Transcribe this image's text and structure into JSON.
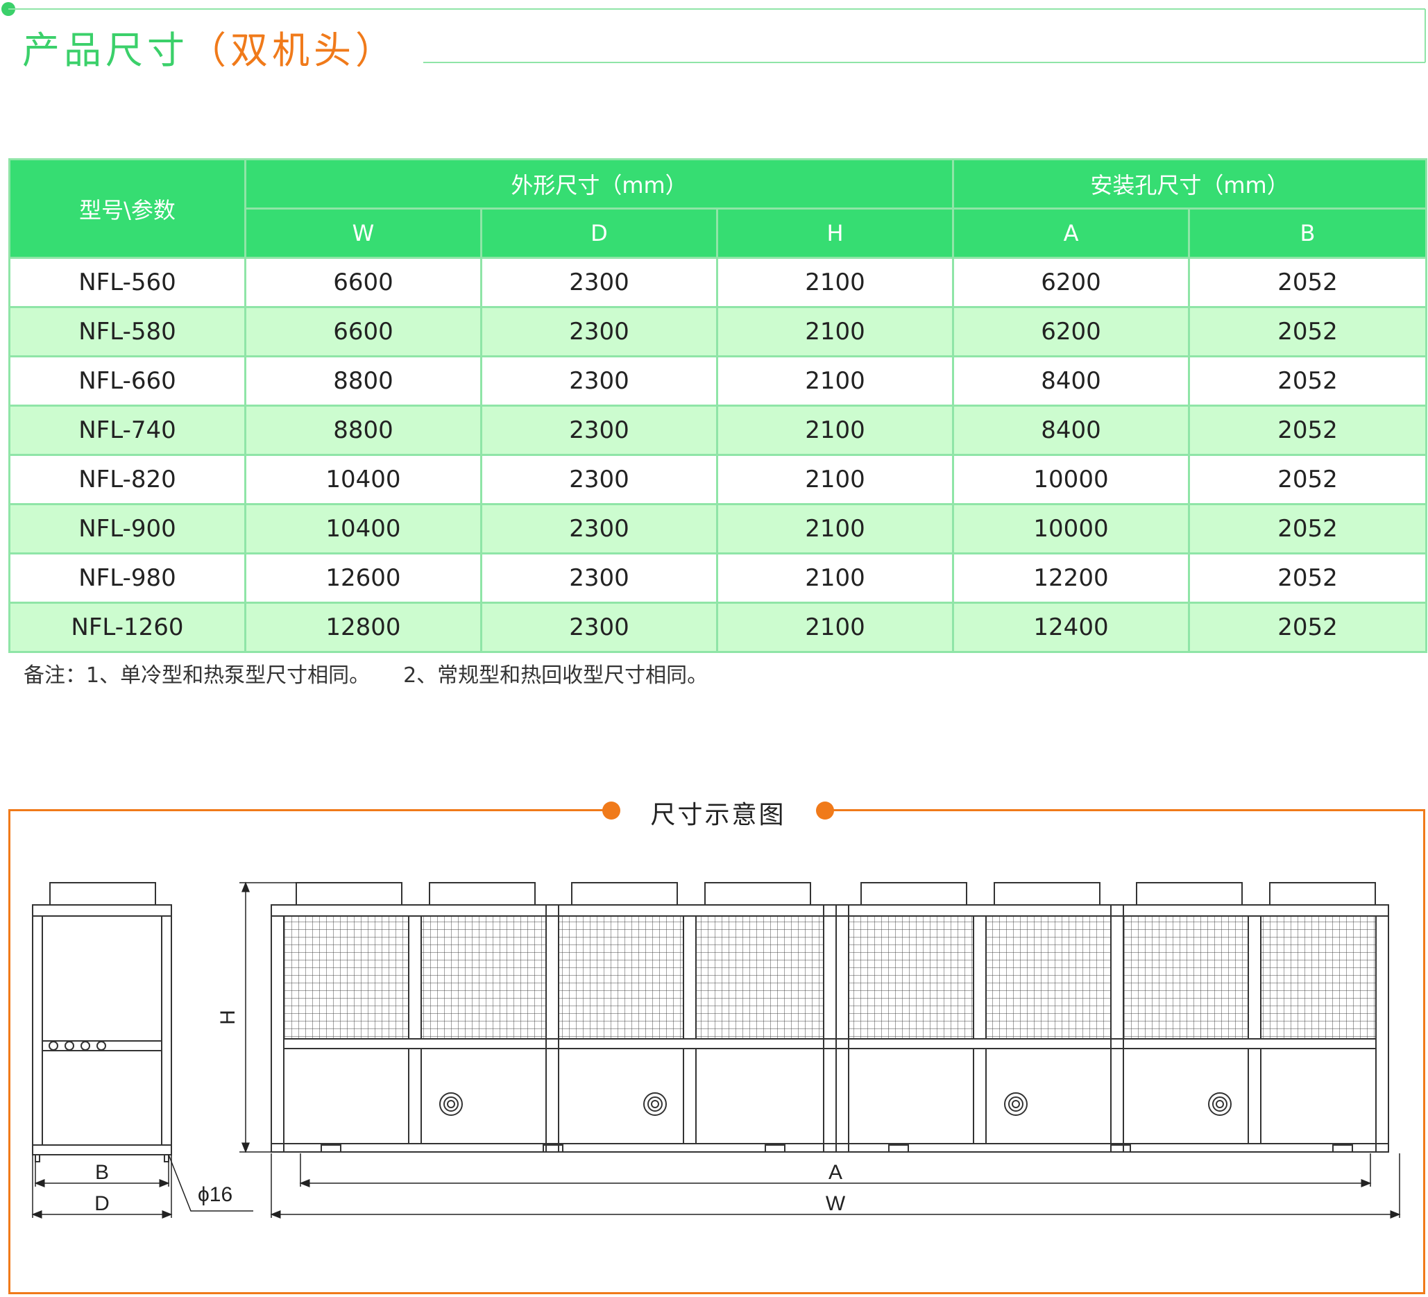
{
  "title": {
    "main": "产品尺寸",
    "sub": "（双机头）"
  },
  "table": {
    "param_header": "型号\\参数",
    "group_outer": "外形尺寸（mm）",
    "group_mount": "安装孔尺寸（mm）",
    "columns": [
      "W",
      "D",
      "H",
      "A",
      "B"
    ],
    "rows": [
      [
        "NFL-560",
        "6600",
        "2300",
        "2100",
        "6200",
        "2052"
      ],
      [
        "NFL-580",
        "6600",
        "2300",
        "2100",
        "6200",
        "2052"
      ],
      [
        "NFL-660",
        "8800",
        "2300",
        "2100",
        "8400",
        "2052"
      ],
      [
        "NFL-740",
        "8800",
        "2300",
        "2100",
        "8400",
        "2052"
      ],
      [
        "NFL-820",
        "10400",
        "2300",
        "2100",
        "10000",
        "2052"
      ],
      [
        "NFL-900",
        "10400",
        "2300",
        "2100",
        "10000",
        "2052"
      ],
      [
        "NFL-980",
        "12600",
        "2300",
        "2100",
        "12200",
        "2052"
      ],
      [
        "NFL-1260",
        "12800",
        "2300",
        "2100",
        "12400",
        "2052"
      ]
    ]
  },
  "note": {
    "part1": "备注：1、单冷型和热泵型尺寸相同。",
    "part2": "2、常规型和热回收型尺寸相同。"
  },
  "diagram": {
    "title": "尺寸示意图",
    "labels": {
      "B": "B",
      "D": "D",
      "pipe": "ϕ16",
      "H": "H",
      "A": "A",
      "W": "W"
    }
  },
  "colors": {
    "accent_green": "#36dd72",
    "row_alt_green": "#ccfccf",
    "title_orange": "#f07a1a",
    "title_green": "#3bd06a"
  }
}
